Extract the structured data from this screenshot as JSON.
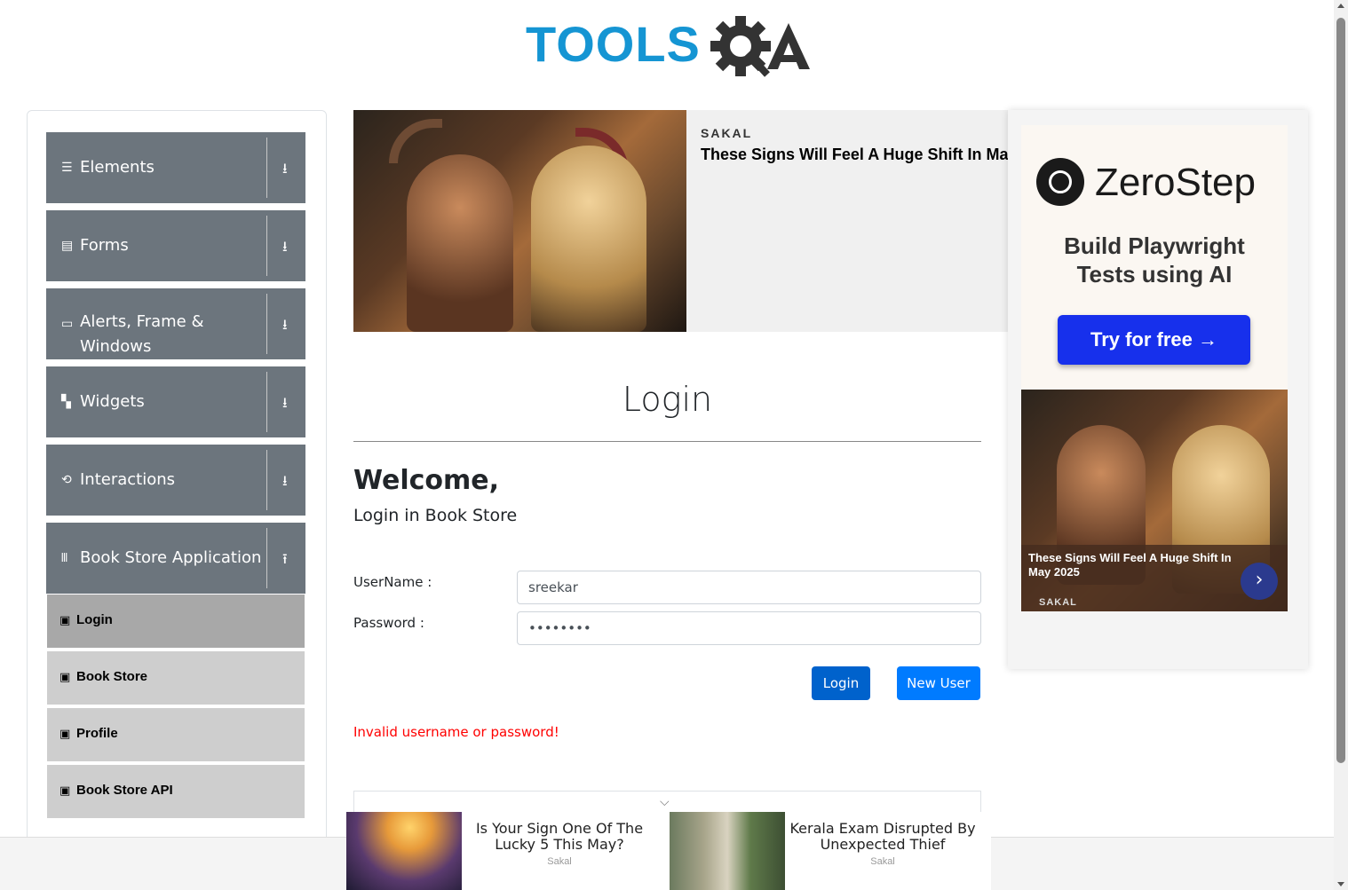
{
  "header": {
    "logo_left": "TOOLS",
    "logo_right": "QA"
  },
  "sidebar": {
    "groups": [
      {
        "label": "Elements",
        "icon": "list-icon"
      },
      {
        "label": "Forms",
        "icon": "form-icon"
      },
      {
        "label": "Alerts, Frame & Windows",
        "icon": "window-icon"
      },
      {
        "label": "Widgets",
        "icon": "widgets-icon"
      },
      {
        "label": "Interactions",
        "icon": "interactions-icon"
      },
      {
        "label": "Book Store Application",
        "icon": "books-icon"
      }
    ],
    "book_store_items": [
      {
        "label": "Login",
        "active": true
      },
      {
        "label": "Book Store",
        "active": false
      },
      {
        "label": "Profile",
        "active": false
      },
      {
        "label": "Book Store API",
        "active": false
      }
    ]
  },
  "ad_top": {
    "source": "SAKAL",
    "headline": "These Signs Will Feel A Huge Shift In Ma"
  },
  "ad_right": {
    "brand": "ZeroStep",
    "tagline_line1": "Build Playwright",
    "tagline_line2": "Tests using AI",
    "cta": "Try for free →",
    "card_headline": "These Signs Will Feel A Huge Shift In May 2025",
    "card_source": "SAKAL"
  },
  "login": {
    "title": "Login",
    "welcome": "Welcome,",
    "subtitle": "Login in Book Store",
    "username_label": "UserName :",
    "username_value": "sreekar",
    "password_label": "Password :",
    "password_value": "••••••••",
    "login_button": "Login",
    "new_user_button": "New User",
    "error": "Invalid username or password!"
  },
  "bottom_ad": {
    "item1_title": "Is Your Sign One Of The Lucky 5 This May?",
    "item1_source": "Sakal",
    "item2_title": "Kerala Exam Disrupted By Unexpected Thief",
    "item2_source": "Sakal"
  }
}
